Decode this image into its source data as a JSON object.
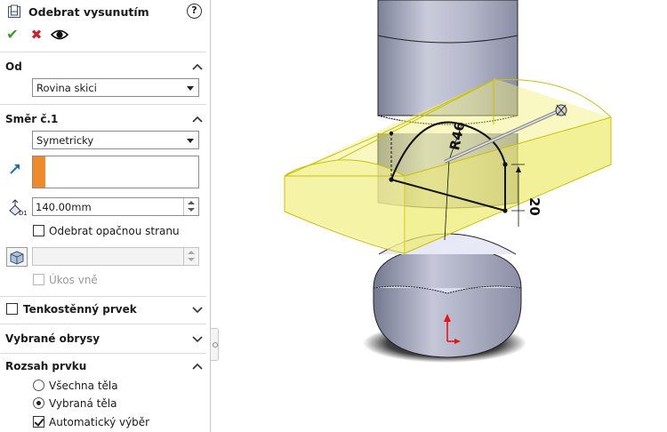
{
  "panel": {
    "title": "Odebrat vysunutím",
    "help_label": "?",
    "ok_label": "✔",
    "cancel_label": "✖",
    "preview_label": "👁"
  },
  "sections": {
    "od": {
      "header": "Od",
      "combo_value": "Rovina skici"
    },
    "smer1": {
      "header": "Směr č.1",
      "combo_value": "Symetricky",
      "depth_value": "140.00mm",
      "flip_side_label": "Odebrat opačnou stranu",
      "flip_side_checked": false,
      "draft_value": "",
      "draft_out_label": "Úkos vně",
      "draft_out_checked": false
    },
    "thin": {
      "header": "Tenkostěnný prvek",
      "checked": false
    },
    "contours": {
      "header": "Vybrané obrysy"
    },
    "scope": {
      "header": "Rozsah prvku",
      "all_bodies_label": "Všechna těla",
      "selected_bodies_label": "Vybraná těla",
      "selected_option": "Vybraná těla",
      "auto_select_label": "Automatický výběr",
      "auto_select_checked": true
    }
  },
  "viewport": {
    "dimension_radius": "R46",
    "dimension_height": "20"
  },
  "colors": {
    "accent_orange": "#f0892a",
    "ok_green": "#3a9a2c",
    "cancel_red": "#d0202a",
    "preview_yellow": "#f2ef7a",
    "body_gray": "#b8bccc"
  }
}
